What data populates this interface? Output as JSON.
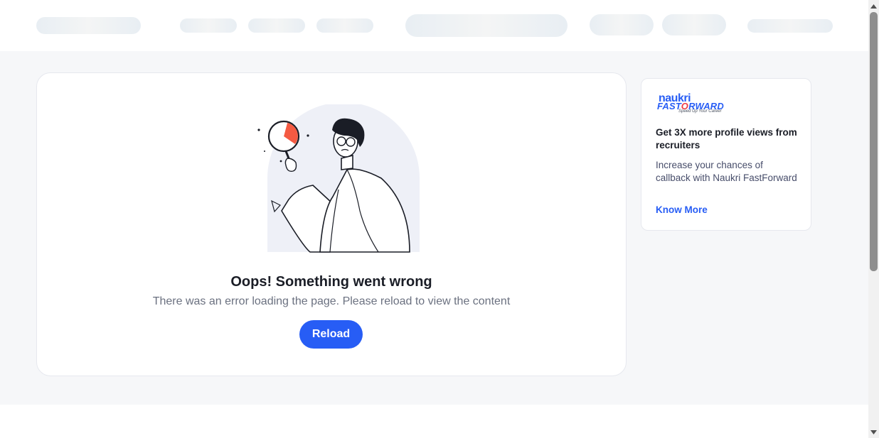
{
  "error": {
    "title": "Oops! Something went wrong",
    "message": "There was an error loading the page. Please reload to view the content",
    "reload_label": "Reload"
  },
  "promo": {
    "logo_naukri": "naukri",
    "logo_fastforward_prefix": "FAST",
    "logo_fastforward_o": "O",
    "logo_fastforward_suffix": "RWARD",
    "logo_tagline": "Speed Up Your Career",
    "title": "Get 3X more profile views from recruiters",
    "body": "Increase your chances of callback with Naukri FastForward",
    "link_label": "Know More"
  },
  "icons": {
    "illustration": "magnifier-person-illustration",
    "scroll_up": "arrow-up-icon",
    "scroll_down": "arrow-down-icon"
  },
  "colors": {
    "primary": "#275df5",
    "accent_red": "#ef3b43",
    "title_text": "#1a1d26",
    "muted_text": "#6b7180",
    "page_bg": "#f6f7f9"
  }
}
